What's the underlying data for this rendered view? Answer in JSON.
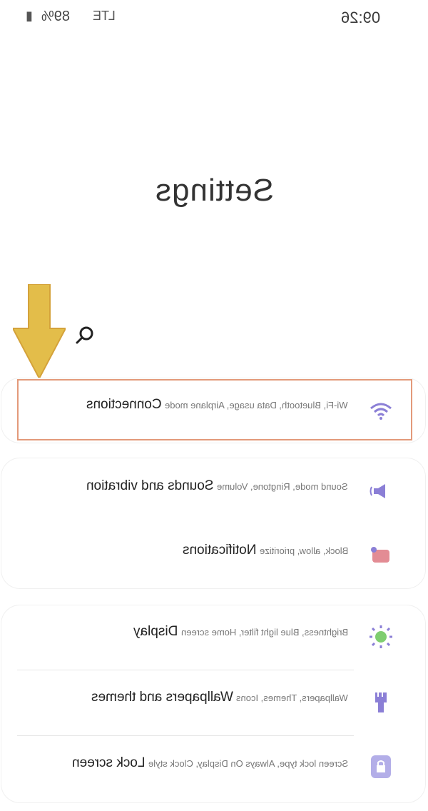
{
  "status_bar": {
    "time": "09:26",
    "battery": "89%",
    "network": "LTE"
  },
  "page": {
    "title": "Settings"
  },
  "search": {
    "icon": "search-icon"
  },
  "items": [
    {
      "label": "Connections",
      "sub": "Wi-Fi, Bluetooth, Data usage, Airplane mode",
      "icon": "wifi-icon"
    },
    {
      "label": "Sounds and vibration",
      "sub": "Sound mode, Ringtone, Volume",
      "icon": "speaker-icon"
    },
    {
      "label": "Notifications",
      "sub": "Block, allow, prioritize",
      "icon": "notification-icon"
    },
    {
      "label": "Display",
      "sub": "Brightness, Blue light filter, Home screen",
      "icon": "brightness-icon"
    },
    {
      "label": "Wallpapers and themes",
      "sub": "Wallpapers, Themes, Icons",
      "icon": "brush-icon"
    },
    {
      "label": "Lock screen",
      "sub": "Screen lock type, Always On Display, Clock style",
      "icon": "lock-icon"
    }
  ],
  "colors": {
    "accent": "#8b7fd6",
    "highlight": "#e39a7a",
    "arrow": "#e3bd4a"
  }
}
